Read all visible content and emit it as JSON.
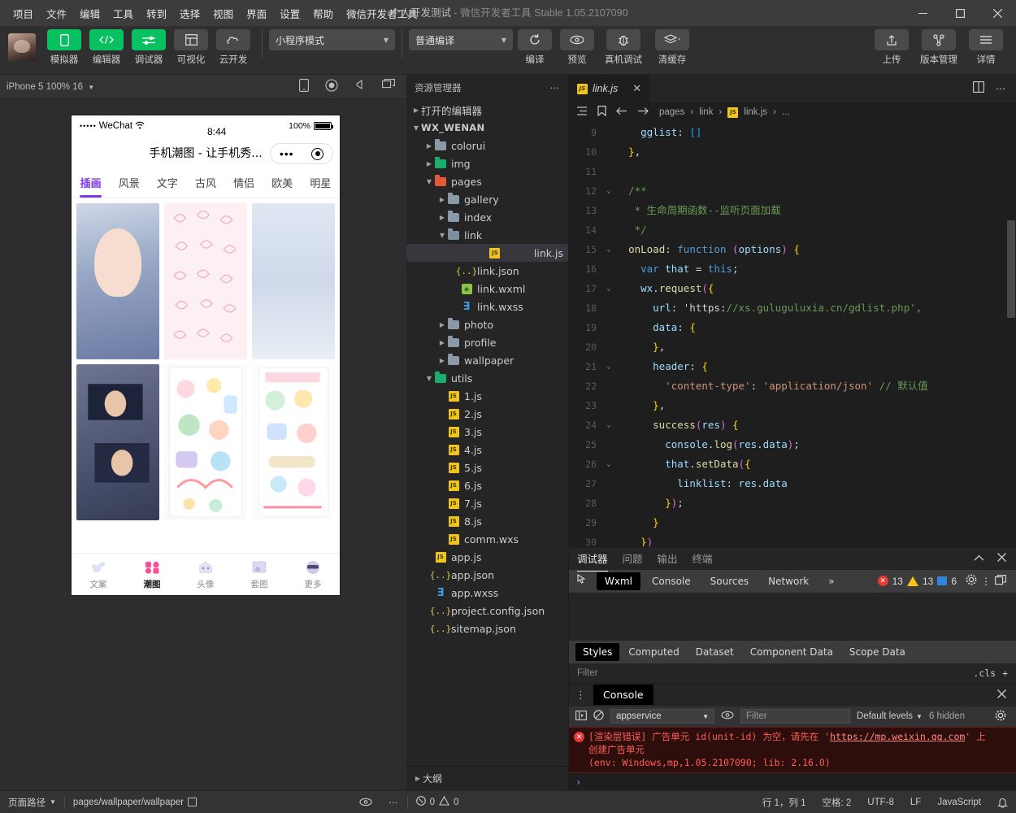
{
  "menubar": {
    "items": [
      "项目",
      "文件",
      "编辑",
      "工具",
      "转到",
      "选择",
      "视图",
      "界面",
      "设置",
      "帮助",
      "微信开发者工具"
    ],
    "title_project": "个人开发测试",
    "title_dash": "-",
    "title_app": "微信开发者工具",
    "title_version": "Stable 1.05.2107090",
    "minimize": "—",
    "maximize": "▢",
    "close": "✕"
  },
  "toolbar": {
    "buttons": [
      {
        "label": "模拟器",
        "icon": "phone-icon",
        "green": true
      },
      {
        "label": "编辑器",
        "icon": "code-icon",
        "green": true
      },
      {
        "label": "调试器",
        "icon": "debug-slider-icon",
        "green": true
      },
      {
        "label": "可视化",
        "icon": "layout-icon",
        "green": false
      },
      {
        "label": "云开发",
        "icon": "cloud-icon",
        "green": false
      }
    ],
    "mode_select": "小程序模式",
    "compile_select": "普通编译",
    "actions": [
      {
        "label": "编译",
        "icon": "refresh-icon"
      },
      {
        "label": "预览",
        "icon": "eye-icon"
      },
      {
        "label": "真机调试",
        "icon": "bug-icon"
      },
      {
        "label": "清缓存",
        "icon": "layers-icon"
      }
    ],
    "right_actions": [
      {
        "label": "上传",
        "icon": "upload-icon"
      },
      {
        "label": "版本管理",
        "icon": "branch-icon"
      },
      {
        "label": "详情",
        "icon": "menu-icon"
      }
    ]
  },
  "simulator": {
    "device_label": "iPhone 5 100% 16",
    "toolbar_icons": [
      "phone-rotate-icon",
      "record-icon",
      "volume-icon",
      "screen-icon"
    ],
    "phone": {
      "status": {
        "carrier": "WeChat",
        "dots": "•••••",
        "time": "8:44",
        "battery_pct": "100%"
      },
      "nav_title": "手机潮图 - 让手机秀...",
      "capsule": {
        "more": "•••",
        "target": "target-icon"
      },
      "tabs": [
        "插画",
        "风景",
        "文字",
        "古风",
        "情侣",
        "欧美",
        "明星"
      ],
      "active_tab": "插画",
      "tabbar": [
        {
          "label": "文案",
          "icon": "hearts-icon",
          "active": false
        },
        {
          "label": "潮图",
          "icon": "grid-icon",
          "active": true
        },
        {
          "label": "头像",
          "icon": "ghost-icon",
          "active": false
        },
        {
          "label": "套图",
          "icon": "stamp-icon",
          "active": false
        },
        {
          "label": "更多",
          "icon": "sunglasses-icon",
          "active": false
        }
      ]
    }
  },
  "explorer": {
    "title": "资源管理器",
    "more": "⋯",
    "outline": "大纲",
    "tree": [
      {
        "label": "打开的编辑器",
        "depth": 0,
        "type": "section",
        "arrow": "collapsed"
      },
      {
        "label": "WX_WENAN",
        "depth": 0,
        "type": "root",
        "arrow": "expanded"
      },
      {
        "label": "colorui",
        "depth": 1,
        "type": "folder",
        "arrow": "collapsed"
      },
      {
        "label": "img",
        "depth": 1,
        "type": "folder-green",
        "arrow": "collapsed"
      },
      {
        "label": "pages",
        "depth": 1,
        "type": "folder-red",
        "arrow": "expanded"
      },
      {
        "label": "gallery",
        "depth": 2,
        "type": "folder",
        "arrow": "collapsed"
      },
      {
        "label": "index",
        "depth": 2,
        "type": "folder",
        "arrow": "collapsed"
      },
      {
        "label": "link",
        "depth": 2,
        "type": "folder-open",
        "arrow": "expanded"
      },
      {
        "label": "link.js",
        "depth": 3,
        "type": "js",
        "arrow": "none",
        "selected": true
      },
      {
        "label": "link.json",
        "depth": 3,
        "type": "json",
        "arrow": "none"
      },
      {
        "label": "link.wxml",
        "depth": 3,
        "type": "wxml",
        "arrow": "none"
      },
      {
        "label": "link.wxss",
        "depth": 3,
        "type": "wxss",
        "arrow": "none"
      },
      {
        "label": "photo",
        "depth": 2,
        "type": "folder",
        "arrow": "collapsed"
      },
      {
        "label": "profile",
        "depth": 2,
        "type": "folder",
        "arrow": "collapsed"
      },
      {
        "label": "wallpaper",
        "depth": 2,
        "type": "folder",
        "arrow": "collapsed"
      },
      {
        "label": "utils",
        "depth": 1,
        "type": "folder-green",
        "arrow": "expanded"
      },
      {
        "label": "1.js",
        "depth": 2,
        "type": "js",
        "arrow": "none"
      },
      {
        "label": "2.js",
        "depth": 2,
        "type": "js",
        "arrow": "none"
      },
      {
        "label": "3.js",
        "depth": 2,
        "type": "js",
        "arrow": "none"
      },
      {
        "label": "4.js",
        "depth": 2,
        "type": "js",
        "arrow": "none"
      },
      {
        "label": "5.js",
        "depth": 2,
        "type": "js",
        "arrow": "none"
      },
      {
        "label": "6.js",
        "depth": 2,
        "type": "js",
        "arrow": "none"
      },
      {
        "label": "7.js",
        "depth": 2,
        "type": "js",
        "arrow": "none"
      },
      {
        "label": "8.js",
        "depth": 2,
        "type": "js",
        "arrow": "none"
      },
      {
        "label": "comm.wxs",
        "depth": 2,
        "type": "js",
        "arrow": "none"
      },
      {
        "label": "app.js",
        "depth": 1,
        "type": "js",
        "arrow": "none"
      },
      {
        "label": "app.json",
        "depth": 1,
        "type": "json",
        "arrow": "none"
      },
      {
        "label": "app.wxss",
        "depth": 1,
        "type": "wxss",
        "arrow": "none"
      },
      {
        "label": "project.config.json",
        "depth": 1,
        "type": "json",
        "arrow": "none"
      },
      {
        "label": "sitemap.json",
        "depth": 1,
        "type": "json",
        "arrow": "none"
      }
    ]
  },
  "editor": {
    "tab": {
      "name": "link.js",
      "icon": "js-icon",
      "close": "✕"
    },
    "tab_actions": [
      "split-editor-icon",
      "more-icon"
    ],
    "breadcrumb_icons": [
      "outline-icon",
      "bookmark-icon",
      "back-arrow-icon",
      "forward-arrow-icon"
    ],
    "breadcrumb": [
      "pages",
      "link",
      "link.js",
      "..."
    ],
    "lines": [
      {
        "n": "9",
        "fold": "",
        "text": "    gglist: []"
      },
      {
        "n": "10",
        "fold": "",
        "text": "  },"
      },
      {
        "n": "11",
        "fold": "",
        "text": ""
      },
      {
        "n": "12",
        "fold": "v",
        "text": "  /**"
      },
      {
        "n": "13",
        "fold": "",
        "text": "   * 生命周期函数--监听页面加载"
      },
      {
        "n": "14",
        "fold": "",
        "text": "   */"
      },
      {
        "n": "15",
        "fold": "v",
        "text": "  onLoad: function (options) {"
      },
      {
        "n": "16",
        "fold": "",
        "text": "    var that = this;"
      },
      {
        "n": "17",
        "fold": "v",
        "text": "    wx.request({"
      },
      {
        "n": "18",
        "fold": "",
        "text": "      url: 'https://xs.guluguluxia.cn/gdlist.php',"
      },
      {
        "n": "19",
        "fold": "",
        "text": "      data: {"
      },
      {
        "n": "20",
        "fold": "",
        "text": "      },"
      },
      {
        "n": "21",
        "fold": "v",
        "text": "      header: {"
      },
      {
        "n": "22",
        "fold": "",
        "text": "        'content-type': 'application/json' // 默认值"
      },
      {
        "n": "23",
        "fold": "",
        "text": "      },"
      },
      {
        "n": "24",
        "fold": "v",
        "text": "      success(res) {"
      },
      {
        "n": "25",
        "fold": "",
        "text": "        console.log(res.data);"
      },
      {
        "n": "26",
        "fold": "v",
        "text": "        that.setData({"
      },
      {
        "n": "27",
        "fold": "",
        "text": "          linklist: res.data"
      },
      {
        "n": "28",
        "fold": "",
        "text": "        });"
      },
      {
        "n": "29",
        "fold": "",
        "text": "      }"
      },
      {
        "n": "30",
        "fold": "",
        "text": "    })"
      }
    ]
  },
  "debugger": {
    "panel_tabs": [
      "调试器",
      "问题",
      "输出",
      "终端"
    ],
    "active_panel_tab": "调试器",
    "panel_actions": [
      "collapse-icon",
      "close-icon"
    ],
    "devtool_tabs": [
      "Wxml",
      "Console",
      "Sources",
      "Network"
    ],
    "active_devtool_tab": "Wxml",
    "overflow": "»",
    "counts": {
      "errors": "13",
      "warnings": "13",
      "info": "6"
    },
    "right_icons": [
      "gear-icon",
      "kebab-icon",
      "dock-icon"
    ],
    "style_tabs": [
      "Styles",
      "Computed",
      "Dataset",
      "Component Data",
      "Scope Data"
    ],
    "active_style_tab": "Styles",
    "filter_placeholder": "Filter",
    "cls_label": ".cls",
    "plus_label": "+"
  },
  "console": {
    "tab": "Console",
    "close": "✕",
    "context": "appservice",
    "filter_placeholder": "Filter",
    "levels": "Default levels",
    "hidden": "6 hidden",
    "messages": [
      {
        "type": "error",
        "line1_a": "[渲染层错误] 广告单元 id(unit-id) 为空，请先在 '",
        "link": "https://mp.weixin.qq.com",
        "line1_b": "' 上",
        "line2": "创建广告单元",
        "line3": "(env: Windows,mp,1.05.2107090; lib: 2.16.0)"
      }
    ],
    "prompt": "›"
  },
  "statusbar": {
    "page_path_label": "页面路径",
    "page_path": "pages/wallpaper/wallpaper",
    "copy_icon": "copy-icon",
    "eye_icon": "eye-icon",
    "more_icon": "more-icon",
    "errors": "0",
    "warnings": "0",
    "cursor": "行 1，列 1",
    "indent": "空格: 2",
    "encoding": "UTF-8",
    "eol": "LF",
    "language": "JavaScript",
    "bell_icon": "bell-icon"
  },
  "colors": {
    "accent_green": "#07c160",
    "error_red": "#e53935",
    "warn_yellow": "#f5c518",
    "tab_purple": "#7c3aed"
  }
}
